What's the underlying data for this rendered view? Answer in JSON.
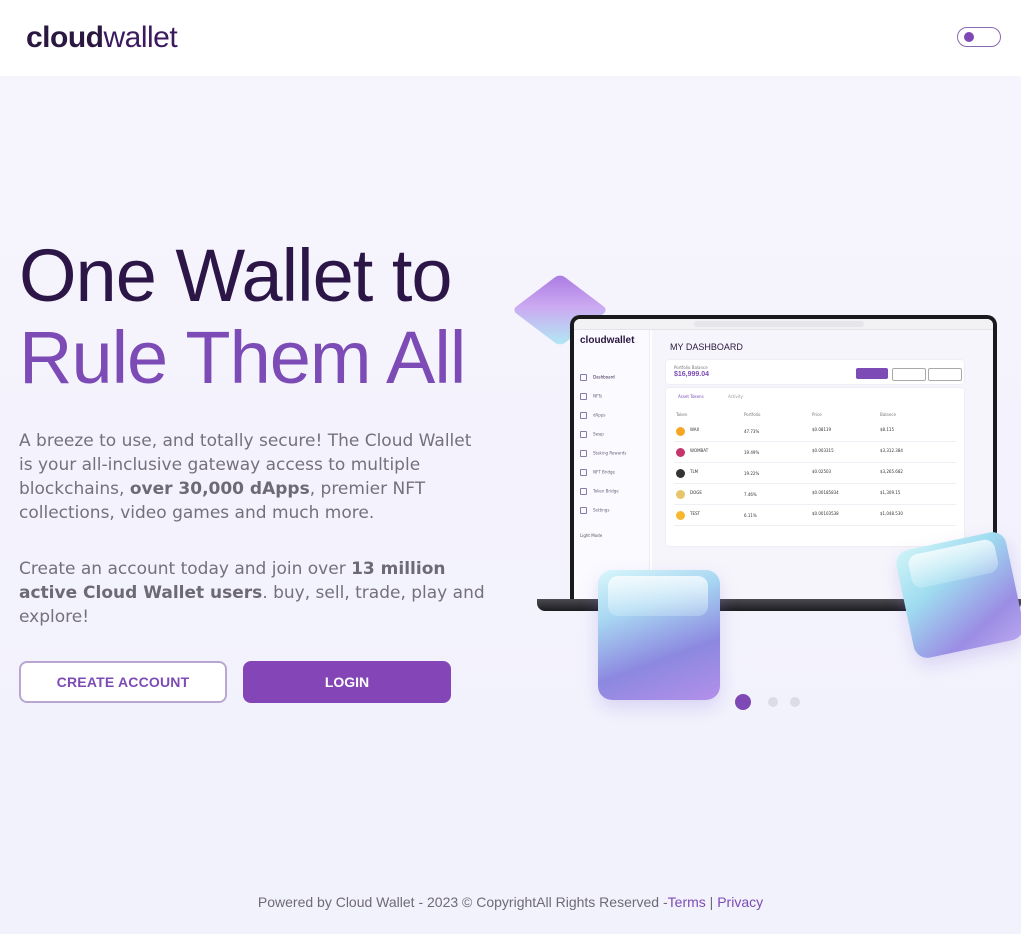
{
  "header": {
    "logo_bold": "cloud",
    "logo_light": "wallet",
    "theme_toggle": "theme-toggle"
  },
  "hero": {
    "line1": "One Wallet to",
    "line2": "Rule Them All",
    "para1_a": "A breeze to use, and totally secure! The Cloud Wallet is your all-inclusive gateway access to multiple blockchains, ",
    "para1_bold": "over 30,000 dApps",
    "para1_b": ", premier NFT collections, video games and much more.",
    "para2_a": "Create an account today and join over ",
    "para2_bold": "13 million active Cloud Wallet users",
    "para2_b": ". buy, sell, trade, play and explore!",
    "create_label": "CREATE ACCOUNT",
    "login_label": "LOGIN"
  },
  "preview": {
    "logo": "cloudwallet",
    "title": "MY DASHBOARD",
    "balance_label": "Portfolio Balance",
    "balance_value": "$16,999.04",
    "sidebar": [
      "Dashboard",
      "NFTs",
      "dApps",
      "Swap",
      "Staking Rewards",
      "NFT Bridge",
      "Token Bridge",
      "Settings"
    ],
    "light_mode": "Light Mode",
    "tabs": [
      "Asset Tokens",
      "Activity"
    ],
    "columns": [
      "Token",
      "Portfolio",
      "Price",
      "Balance"
    ],
    "rows": [
      {
        "token": "WAX",
        "pct": "47.73%",
        "price": "$0.08119",
        "bal": "$8.115"
      },
      {
        "token": "WOMBAT",
        "pct": "19.49%",
        "price": "$0.003315",
        "bal": "$3,312.384"
      },
      {
        "token": "TLM",
        "pct": "19.22%",
        "price": "$0.02503",
        "bal": "$3,265.682"
      },
      {
        "token": "DOGE",
        "pct": "7.46%",
        "price": "$0.00185834",
        "bal": "$1,309.15"
      },
      {
        "token": "TEST",
        "pct": "6.11%",
        "price": "$0.00103538",
        "bal": "$1,048.530"
      }
    ]
  },
  "carousel": {
    "count": 3,
    "active": 1
  },
  "footer": {
    "text": "Powered by Cloud Wallet - 2023 © CopyrightAll Rights Reserved -",
    "terms": "Terms",
    "separator": " | ",
    "privacy": "Privacy"
  },
  "colors": {
    "accent": "#7d4bb5",
    "login_bg": "#8446b6",
    "title_dark": "#2c1547"
  }
}
